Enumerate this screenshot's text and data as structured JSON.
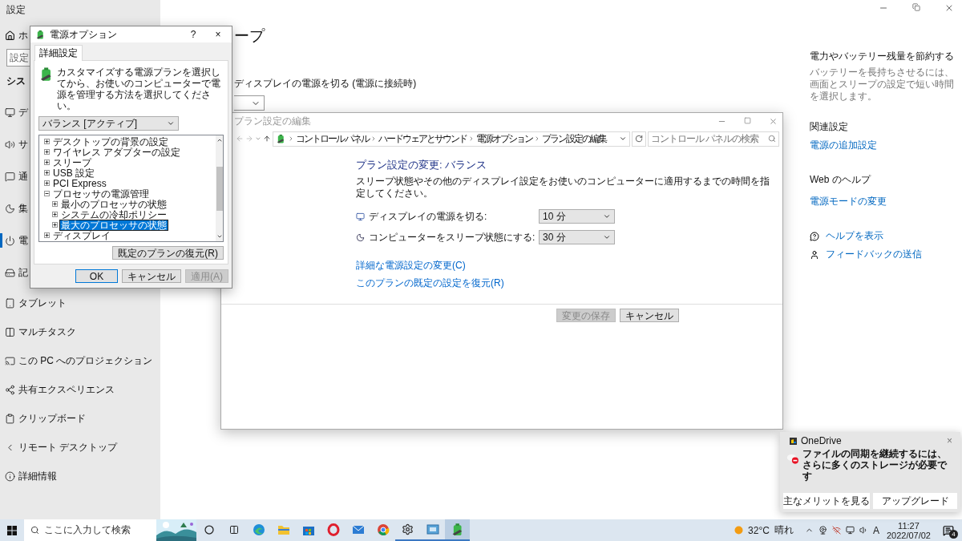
{
  "settings": {
    "title": "設定",
    "home": "ホ",
    "search_placeholder": "設定",
    "section": "シス",
    "nav": [
      {
        "label": "デ",
        "selected": false
      },
      {
        "label": "サ",
        "selected": false
      },
      {
        "label": "通",
        "selected": false
      },
      {
        "label": "集",
        "selected": false
      },
      {
        "label": "電",
        "selected": true
      },
      {
        "label": "記",
        "selected": false
      },
      {
        "label": "タブレット",
        "selected": false
      },
      {
        "label": "マルチタスク",
        "selected": false
      },
      {
        "label": "この PC へのプロジェクション",
        "selected": false
      },
      {
        "label": "共有エクスペリエンス",
        "selected": false
      },
      {
        "label": "クリップボード",
        "selected": false
      },
      {
        "label": "リモート デスクトップ",
        "selected": false
      },
      {
        "label": "詳細情報",
        "selected": false
      }
    ],
    "page_title": "ープ",
    "display_off_label": "ディスプレイの電源を切る (電源に接続時)",
    "aside": {
      "save_heading": "電力やバッテリー残量を節約する",
      "save_text": "バッテリーを長持ちさせるには、画面とスリープの設定で短い時間を選択します。",
      "related_heading": "関連設定",
      "related_link": "電源の追加設定",
      "web_heading": "Web のヘルプ",
      "web_link": "電源モードの変更",
      "help_links": [
        "ヘルプを表示",
        "フィードバックの送信"
      ]
    }
  },
  "plan_window": {
    "title": "プラン設定の編集",
    "breadcrumbs": [
      "コントロール パネル",
      "ハードウェアとサウンド",
      "電源オプション",
      "プラン設定の編集"
    ],
    "search_placeholder": "コントロール パネルの検索",
    "heading": "プラン設定の変更: バランス",
    "description": "スリープ状態やその他のディスプレイ設定をお使いのコンピューターに適用するまでの時間を指定してください。",
    "settings": [
      {
        "label": "ディスプレイの電源を切る:",
        "value": "10 分"
      },
      {
        "label": "コンピューターをスリープ状態にする:",
        "value": "30 分"
      }
    ],
    "links": [
      "詳細な電源設定の変更(C)",
      "このプランの既定の設定を復元(R)"
    ],
    "buttons": [
      {
        "label": "変更の保存",
        "disabled": true
      },
      {
        "label": "キャンセル",
        "disabled": false
      }
    ]
  },
  "power_dialog": {
    "title": "電源オプション",
    "help": "?",
    "close": "×",
    "tabs": [
      {
        "label": "詳細設定",
        "selected": true
      }
    ],
    "description": "カスタマイズする電源プランを選択してから、お使いのコンピューターで電源を管理する方法を選択してください。",
    "plan": "バランス [アクティブ]",
    "tree": [
      {
        "label": "デスクトップの背景の設定",
        "expanded": false,
        "selected": false
      },
      {
        "label": "ワイヤレス アダプターの設定",
        "expanded": false,
        "selected": false
      },
      {
        "label": "スリープ",
        "expanded": false,
        "selected": false
      },
      {
        "label": "USB 設定",
        "expanded": false,
        "selected": false
      },
      {
        "label": "PCI Express",
        "expanded": false,
        "selected": false
      },
      {
        "label": "プロセッサの電源管理",
        "expanded": true,
        "selected": false,
        "children": [
          {
            "label": "最小のプロセッサの状態",
            "expanded": false,
            "selected": false
          },
          {
            "label": "システムの冷却ポリシー",
            "expanded": false,
            "selected": false
          },
          {
            "label": "最大のプロセッサの状態",
            "expanded": false,
            "selected": true
          }
        ]
      },
      {
        "label": "ディスプレイ",
        "expanded": false,
        "selected": false
      }
    ],
    "restore_button": "既定のプランの復元(R)",
    "buttons": [
      {
        "label": "OK",
        "default": true,
        "disabled": false
      },
      {
        "label": "キャンセル",
        "default": false,
        "disabled": false
      },
      {
        "label": "適用(A)",
        "default": false,
        "disabled": true
      }
    ]
  },
  "toast": {
    "app": "OneDrive",
    "close": "×",
    "message": "ファイルの同期を継続するには、さらに多くのストレージが必要です",
    "buttons": [
      "主なメリットを見る",
      "アップグレード"
    ]
  },
  "taskbar": {
    "search_placeholder": "ここに入力して検索",
    "apps": [
      {
        "running": false,
        "active": false
      },
      {
        "running": false,
        "active": false
      },
      {
        "running": false,
        "active": false
      },
      {
        "running": false,
        "active": false
      },
      {
        "running": false,
        "active": false
      },
      {
        "running": false,
        "active": false
      },
      {
        "running": true,
        "active": false
      },
      {
        "running": true,
        "active": false
      },
      {
        "running": true,
        "active": true
      }
    ],
    "weather": {
      "temp": "32°C",
      "condition": "晴れ"
    },
    "ime": "A",
    "time": "11:27",
    "date": "2022/07/02",
    "notifications": "4"
  }
}
